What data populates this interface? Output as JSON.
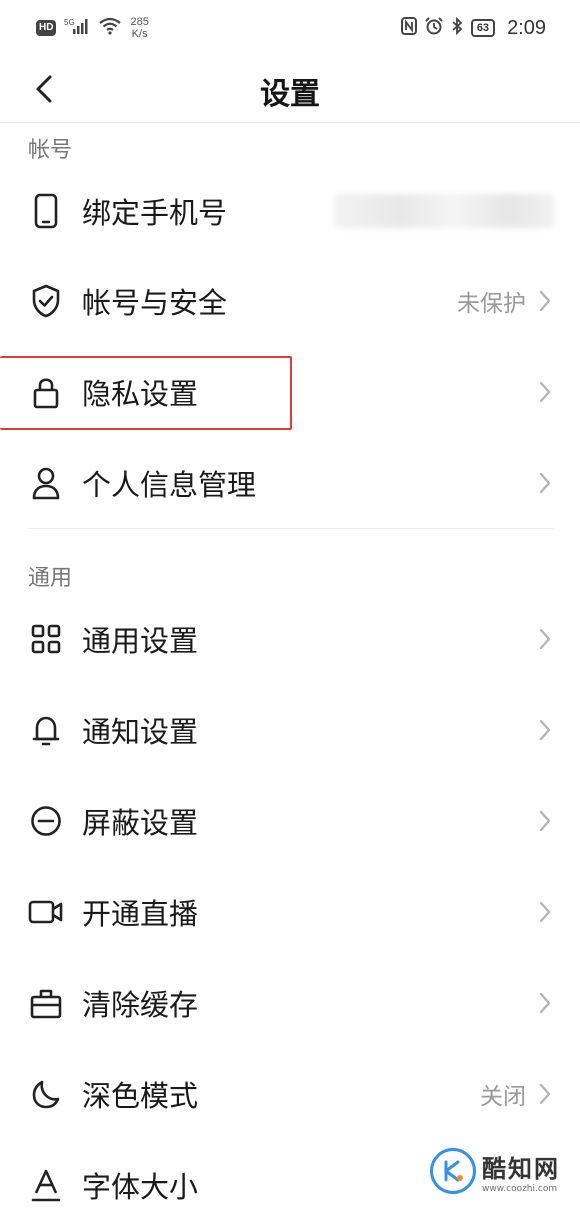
{
  "status_bar": {
    "hd": "HD",
    "signal_tag": "5G",
    "net_speed_value": "285",
    "net_speed_unit": "K/s",
    "battery": "63",
    "time": "2:09"
  },
  "header": {
    "title": "设置"
  },
  "sections": {
    "account": {
      "label": "帐号",
      "items": [
        {
          "label": "绑定手机号",
          "icon": "phone-icon"
        },
        {
          "label": "帐号与安全",
          "icon": "shield-check-icon",
          "value": "未保护"
        },
        {
          "label": "隐私设置",
          "icon": "lock-icon"
        },
        {
          "label": "个人信息管理",
          "icon": "person-icon"
        }
      ]
    },
    "general": {
      "label": "通用",
      "items": [
        {
          "label": "通用设置",
          "icon": "grid-icon"
        },
        {
          "label": "通知设置",
          "icon": "bell-icon"
        },
        {
          "label": "屏蔽设置",
          "icon": "block-icon"
        },
        {
          "label": "开通直播",
          "icon": "video-camera-icon"
        },
        {
          "label": "清除缓存",
          "icon": "briefcase-icon"
        },
        {
          "label": "深色模式",
          "icon": "moon-icon",
          "value": "关闭"
        },
        {
          "label": "字体大小",
          "icon": "font-size-icon"
        }
      ]
    }
  },
  "watermark": {
    "brand": "酷知网",
    "url": "www.coozhi.com"
  },
  "colors": {
    "highlight": "#e23b3b",
    "text": "#1a1a1a",
    "muted": "#9a9a9a"
  }
}
